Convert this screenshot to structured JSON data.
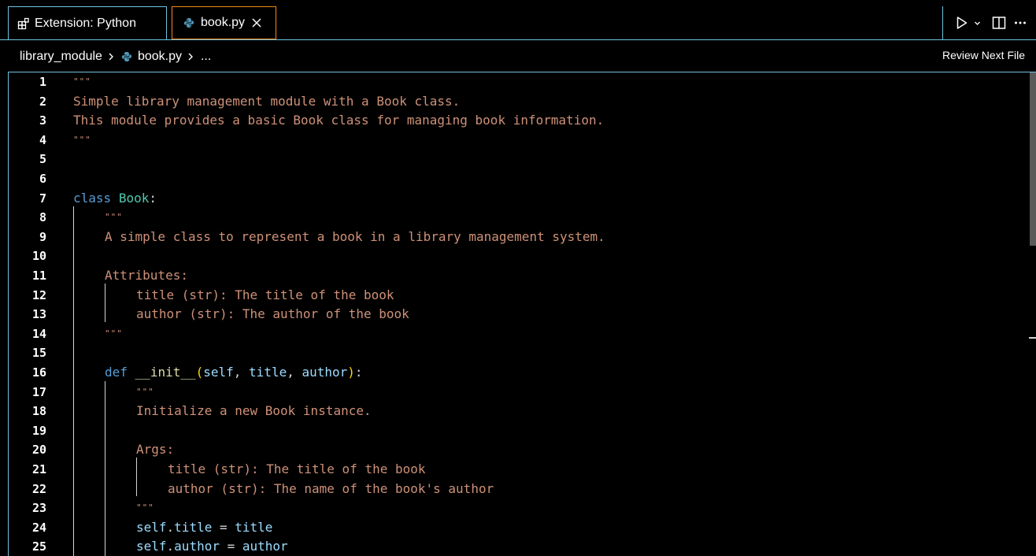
{
  "tabs": [
    {
      "label": "Extension: Python",
      "icon": "extensions-icon",
      "active": false
    },
    {
      "label": "book.py",
      "icon": "python-icon",
      "active": true,
      "close_icon": "close-icon"
    }
  ],
  "editor_actions": [
    "run-icon",
    "chevron-down-icon",
    "split-editor-icon",
    "more-actions-icon"
  ],
  "breadcrumb": {
    "folder": "library_module",
    "file": "book.py",
    "ellipsis": "..."
  },
  "review_next_file": "Review Next File",
  "code_lines": [
    {
      "n": "1"
    },
    {
      "n": "2"
    },
    {
      "n": "3"
    },
    {
      "n": "4"
    },
    {
      "n": "5"
    },
    {
      "n": "6"
    },
    {
      "n": "7"
    },
    {
      "n": "8"
    },
    {
      "n": "9"
    },
    {
      "n": "10"
    },
    {
      "n": "11"
    },
    {
      "n": "12"
    },
    {
      "n": "13"
    },
    {
      "n": "14"
    },
    {
      "n": "15"
    },
    {
      "n": "16"
    },
    {
      "n": "17"
    },
    {
      "n": "18"
    },
    {
      "n": "19"
    },
    {
      "n": "20"
    },
    {
      "n": "21"
    },
    {
      "n": "22"
    },
    {
      "n": "23"
    },
    {
      "n": "24"
    },
    {
      "n": "25"
    }
  ],
  "code": {
    "l1_quote": "\"\"\"",
    "l2": "Simple library management module with a Book class.",
    "l3": "This module provides a basic Book class for managing book information.",
    "l4_quote": "\"\"\"",
    "l7_kw": "class",
    "l7_cls": "Book",
    "l7_colon": ":",
    "l8_quote": "\"\"\"",
    "l9": "A simple class to represent a book in a library management system.",
    "l11": "Attributes:",
    "l12": "title (str): The title of the book",
    "l13": "author (str): The author of the book",
    "l14_quote": "\"\"\"",
    "l16_kw": "def",
    "l16_fn": "__init__",
    "l16_open": "(",
    "l16_p1": "self",
    "l16_c1": ", ",
    "l16_p2": "title",
    "l16_c2": ", ",
    "l16_p3": "author",
    "l16_close": ")",
    "l16_colon": ":",
    "l17_quote": "\"\"\"",
    "l18": "Initialize a new Book instance.",
    "l20": "Args:",
    "l21": "title (str): The title of the book",
    "l22": "author (str): The name of the book's author",
    "l23_quote": "\"\"\"",
    "l24_self": "self",
    "l24_dot": ".",
    "l24_attr": "title",
    "l24_eq": " = ",
    "l24_val": "title",
    "l25_self": "self",
    "l25_dot": ".",
    "l25_attr": "author",
    "l25_eq": " = ",
    "l25_val": "author"
  },
  "colors": {
    "accent_border": "#6fc3df",
    "active_tab_border": "#f38518",
    "string": "#ce9178",
    "keyword": "#569cd6",
    "class_name": "#4ec9b0",
    "function": "#dcdcaa",
    "variable": "#9cdcfe",
    "bracket": "#ffd700"
  }
}
